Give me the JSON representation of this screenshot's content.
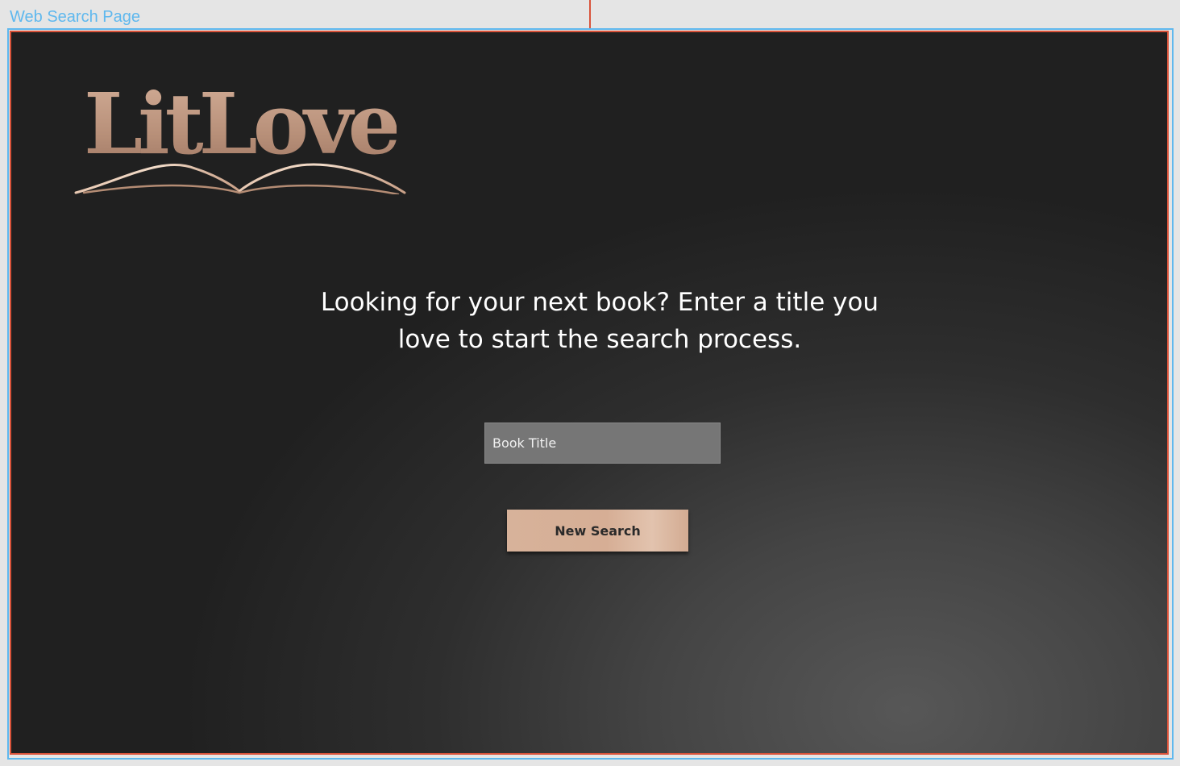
{
  "frame": {
    "label": "Web Search Page"
  },
  "brand": {
    "logo_text": "LitLove",
    "logo_icon": "open-book-icon"
  },
  "main": {
    "headline": "Looking for your next book? Enter a title you love to start the search process.",
    "search": {
      "placeholder": "Book Title",
      "value": ""
    },
    "button_label": "New Search"
  },
  "colors": {
    "frame_outline": "#5fb8ee",
    "guide_line": "#d9533a",
    "background_dark": "#202020",
    "background_glow": "#575757",
    "accent": "#d7b29a",
    "input_fill": "#767676"
  }
}
